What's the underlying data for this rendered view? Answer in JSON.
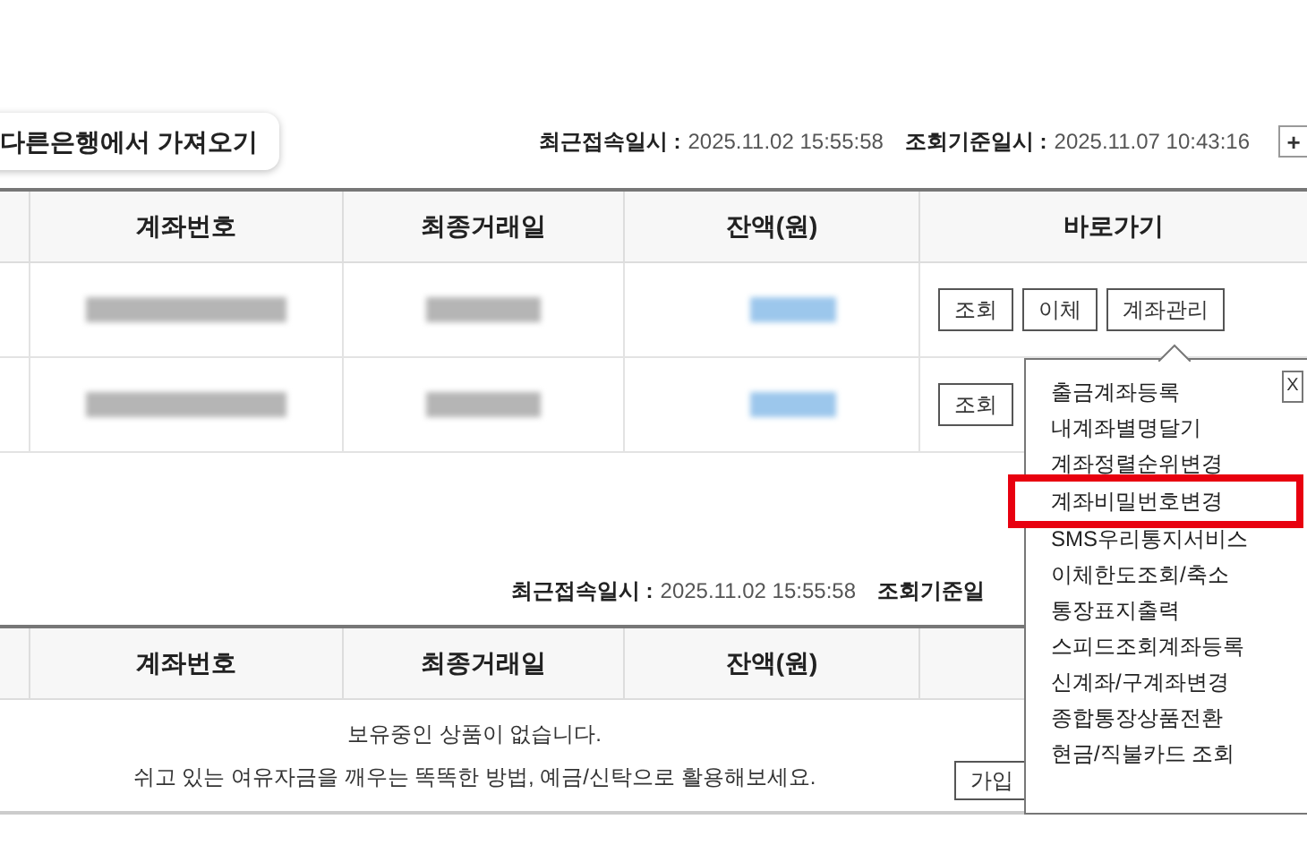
{
  "import_button": "다른은행에서 가져오기",
  "info_top": {
    "last_login_label": "최근접속일시 :",
    "last_login": "2025.11.02 15:55:58",
    "query_label": "조회기준일시 :",
    "query_time": "2025.11.07 10:43:16",
    "expand_button": "+"
  },
  "table1": {
    "columns": [
      "계좌번호",
      "최종거래일",
      "잔액(원)",
      "바로가기"
    ],
    "rows": [
      {
        "buttons": [
          "조회",
          "이체",
          "계좌관리"
        ]
      },
      {
        "buttons": [
          "조회"
        ]
      }
    ]
  },
  "menu": {
    "items": [
      {
        "label": "출금계좌등록",
        "selected": false
      },
      {
        "label": "내계좌별명달기",
        "selected": false
      },
      {
        "label": "계좌정렬순위변경",
        "selected": false
      },
      {
        "label": "계좌비밀번호변경",
        "selected": true
      },
      {
        "label": "SMS우리통지서비스",
        "selected": false
      },
      {
        "label": "이체한도조회/축소",
        "selected": false
      },
      {
        "label": "통장표지출력",
        "selected": false
      },
      {
        "label": "스피드조회계좌등록",
        "selected": false
      },
      {
        "label": "신계좌/구계좌변경",
        "selected": false
      },
      {
        "label": "종합통장상품전환",
        "selected": false
      },
      {
        "label": "현금/직불카드 조회",
        "selected": false
      }
    ],
    "close": "X"
  },
  "info_bottom": {
    "last_login_label": "최근접속일시 :",
    "last_login": "2025.11.02 15:55:58",
    "query_label": "조회기준일"
  },
  "table2": {
    "columns": [
      "계좌번호",
      "최종거래일",
      "잔액(원)"
    ],
    "empty_message": "보유중인 상품이 없습니다.",
    "empty_hint": "쉬고 있는 여유자금을 깨우는 똑똑한 방법, 예금/신탁으로 활용해보세요.",
    "join_button": "가입"
  }
}
